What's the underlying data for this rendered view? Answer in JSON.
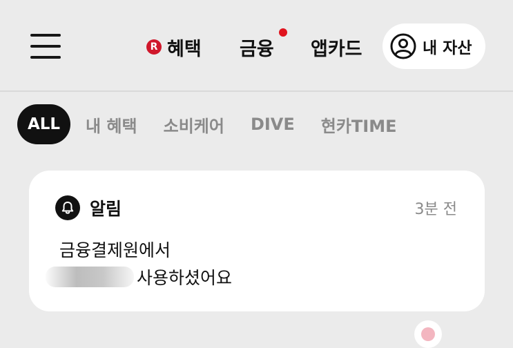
{
  "header": {
    "nav": {
      "benefit": {
        "badge": "R",
        "label": "혜택"
      },
      "finance": {
        "label": "금융",
        "has_notification_dot": true
      },
      "appcard": {
        "label": "앱카드"
      }
    },
    "asset_button": {
      "label": "내 자산",
      "icon": "user-circle-icon"
    }
  },
  "filters": {
    "chips": [
      {
        "label": "ALL",
        "active": true
      },
      {
        "label": "내 혜택",
        "active": false
      },
      {
        "label": "소비케어",
        "active": false
      },
      {
        "label": "DIVE",
        "active": false
      },
      {
        "label": "현카TIME",
        "active": false
      }
    ]
  },
  "notification_card": {
    "icon": "bell-icon",
    "title": "알림",
    "time": "3분 전",
    "line1": "금융결제원에서",
    "line2": "사용하셨어요"
  },
  "colors": {
    "background": "#ebebeb",
    "accent_red": "#d0172b",
    "active_chip": "#111111"
  }
}
